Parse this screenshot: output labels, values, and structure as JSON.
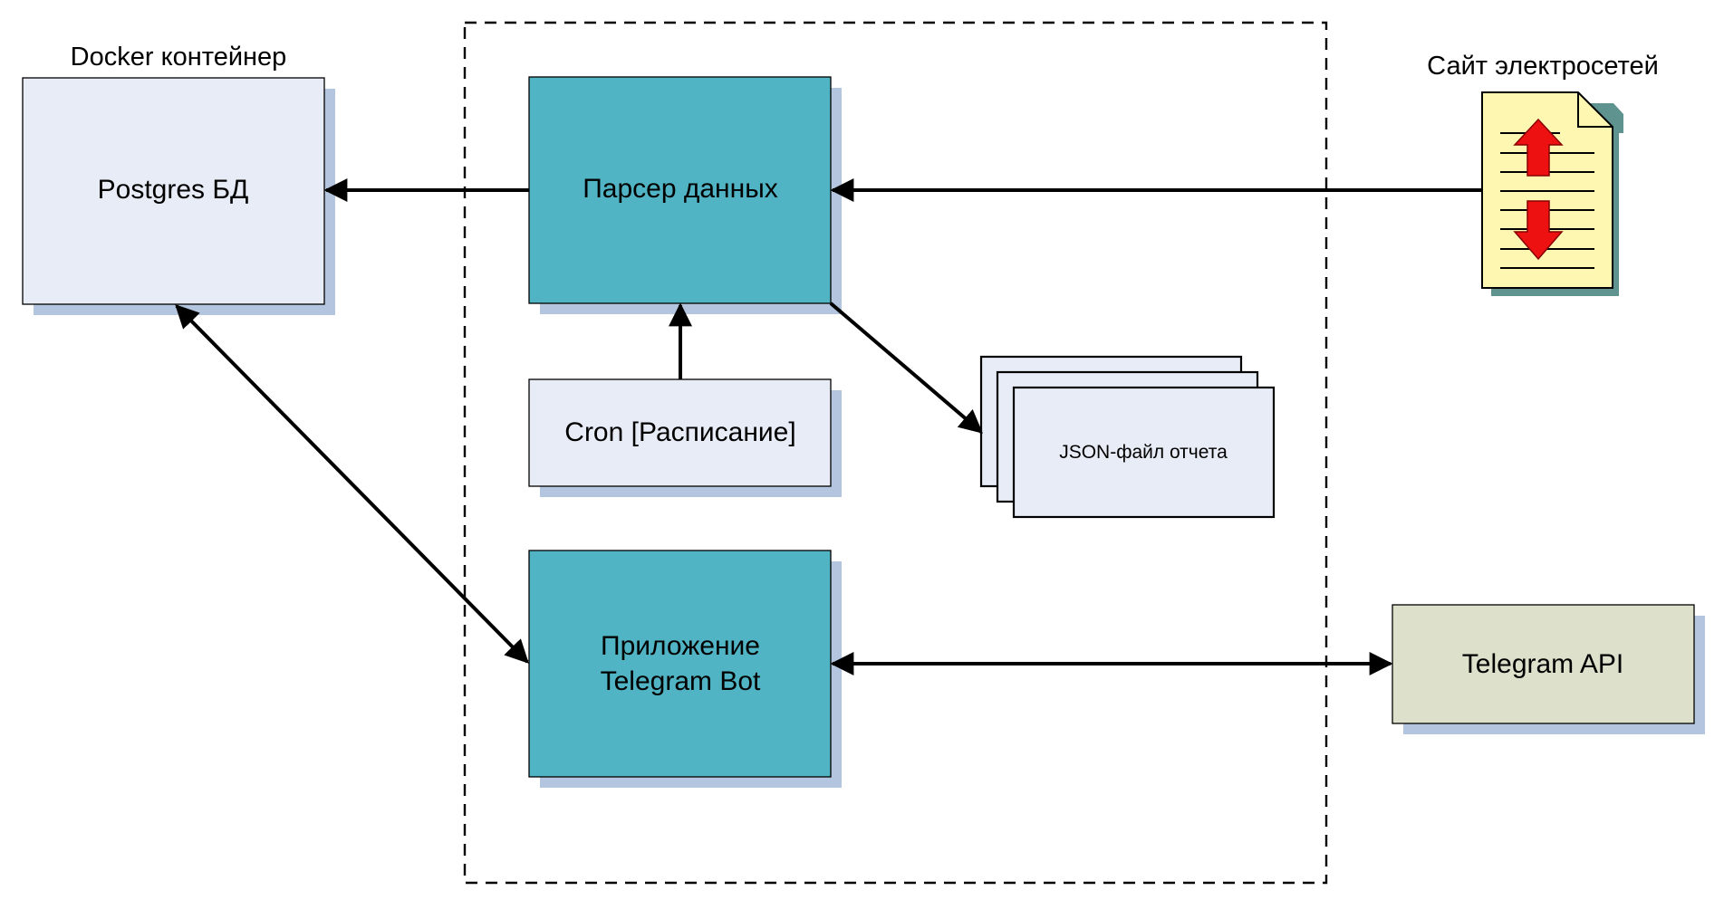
{
  "labels": {
    "docker_container": "Docker контейнер",
    "site": "Сайт электросетей"
  },
  "nodes": {
    "postgres": "Postgres БД",
    "parser": "Парсер данных",
    "cron": "Cron [Расписание]",
    "json_report": "JSON-файл отчета",
    "telegram_bot_line1": "Приложение",
    "telegram_bot_line2": "Telegram Bot",
    "telegram_api": "Telegram API"
  },
  "colors": {
    "teal": "#50b4c4",
    "light_box": "#e8ecf6",
    "shadow": "#b4c6df",
    "telegram_api": "#dde0ca",
    "document": "#fdf7b1",
    "document_shadow": "#5f9390",
    "arrow_red": "#ee1111"
  },
  "icons": {
    "site_document": "web-document-icon"
  }
}
